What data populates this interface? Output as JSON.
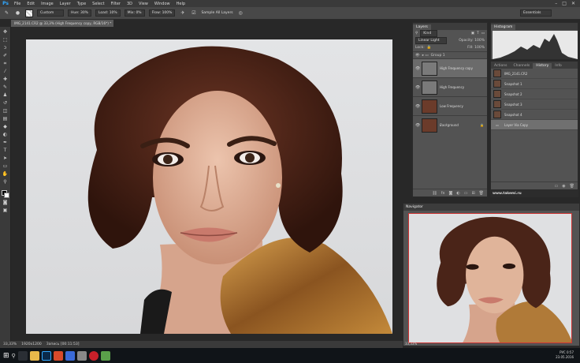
{
  "menu": {
    "logo": "Ps",
    "items": [
      "File",
      "Edit",
      "Image",
      "Layer",
      "Type",
      "Select",
      "Filter",
      "3D",
      "View",
      "Window",
      "Help"
    ]
  },
  "options": {
    "preset": "Custom",
    "hue": "Hue: 30%",
    "load": "Load: 10%",
    "mix": "Mix: 0%",
    "flow": "Flow: 100%",
    "sample": "Sample All Layers",
    "workspace": "Essentials"
  },
  "document": {
    "tab_title": "IMG_2141.CR2 @ 33,3% (High Frequency copy, RGB/16*) *",
    "status_zoom": "33,33%",
    "status_doc": "1920x1200",
    "status_rec": "Запись [00:11:53]"
  },
  "layers": {
    "tabs": [
      "Layers"
    ],
    "kind_label": "Kind",
    "blend_mode": "Linear Light",
    "opacity": "Opacity: 100%",
    "lock": "Lock:",
    "fill": "Fill: 100%",
    "group": "Group 1",
    "items": [
      {
        "name": "High Frequency copy",
        "thumb": "gray"
      },
      {
        "name": "High Frequency",
        "thumb": "gray"
      },
      {
        "name": "Low Frequency",
        "thumb": "portrait"
      },
      {
        "name": "Background",
        "thumb": "portrait"
      }
    ]
  },
  "histogram": {
    "tabs": [
      "Histogram"
    ]
  },
  "history": {
    "tabs": [
      "Actions",
      "Channels",
      "History",
      "Info"
    ],
    "items": [
      "IMG_2141.CR2",
      "Snapshot 1",
      "Snapshot 2",
      "Snapshot 3",
      "Snapshot 4",
      "Layer Via Copy"
    ]
  },
  "watermark": "www.takemi.ru",
  "navigator": {
    "title": "Navigator",
    "zoom": "33,33%"
  },
  "taskbar": {
    "lang": "РУС",
    "time": "0:57",
    "date": "23.05.2016"
  },
  "colors": {
    "accent": "#31a8ff",
    "panel": "#535353",
    "skin": "#e0b49a",
    "hair": "#4a2418",
    "sequins": "#b87a30"
  }
}
